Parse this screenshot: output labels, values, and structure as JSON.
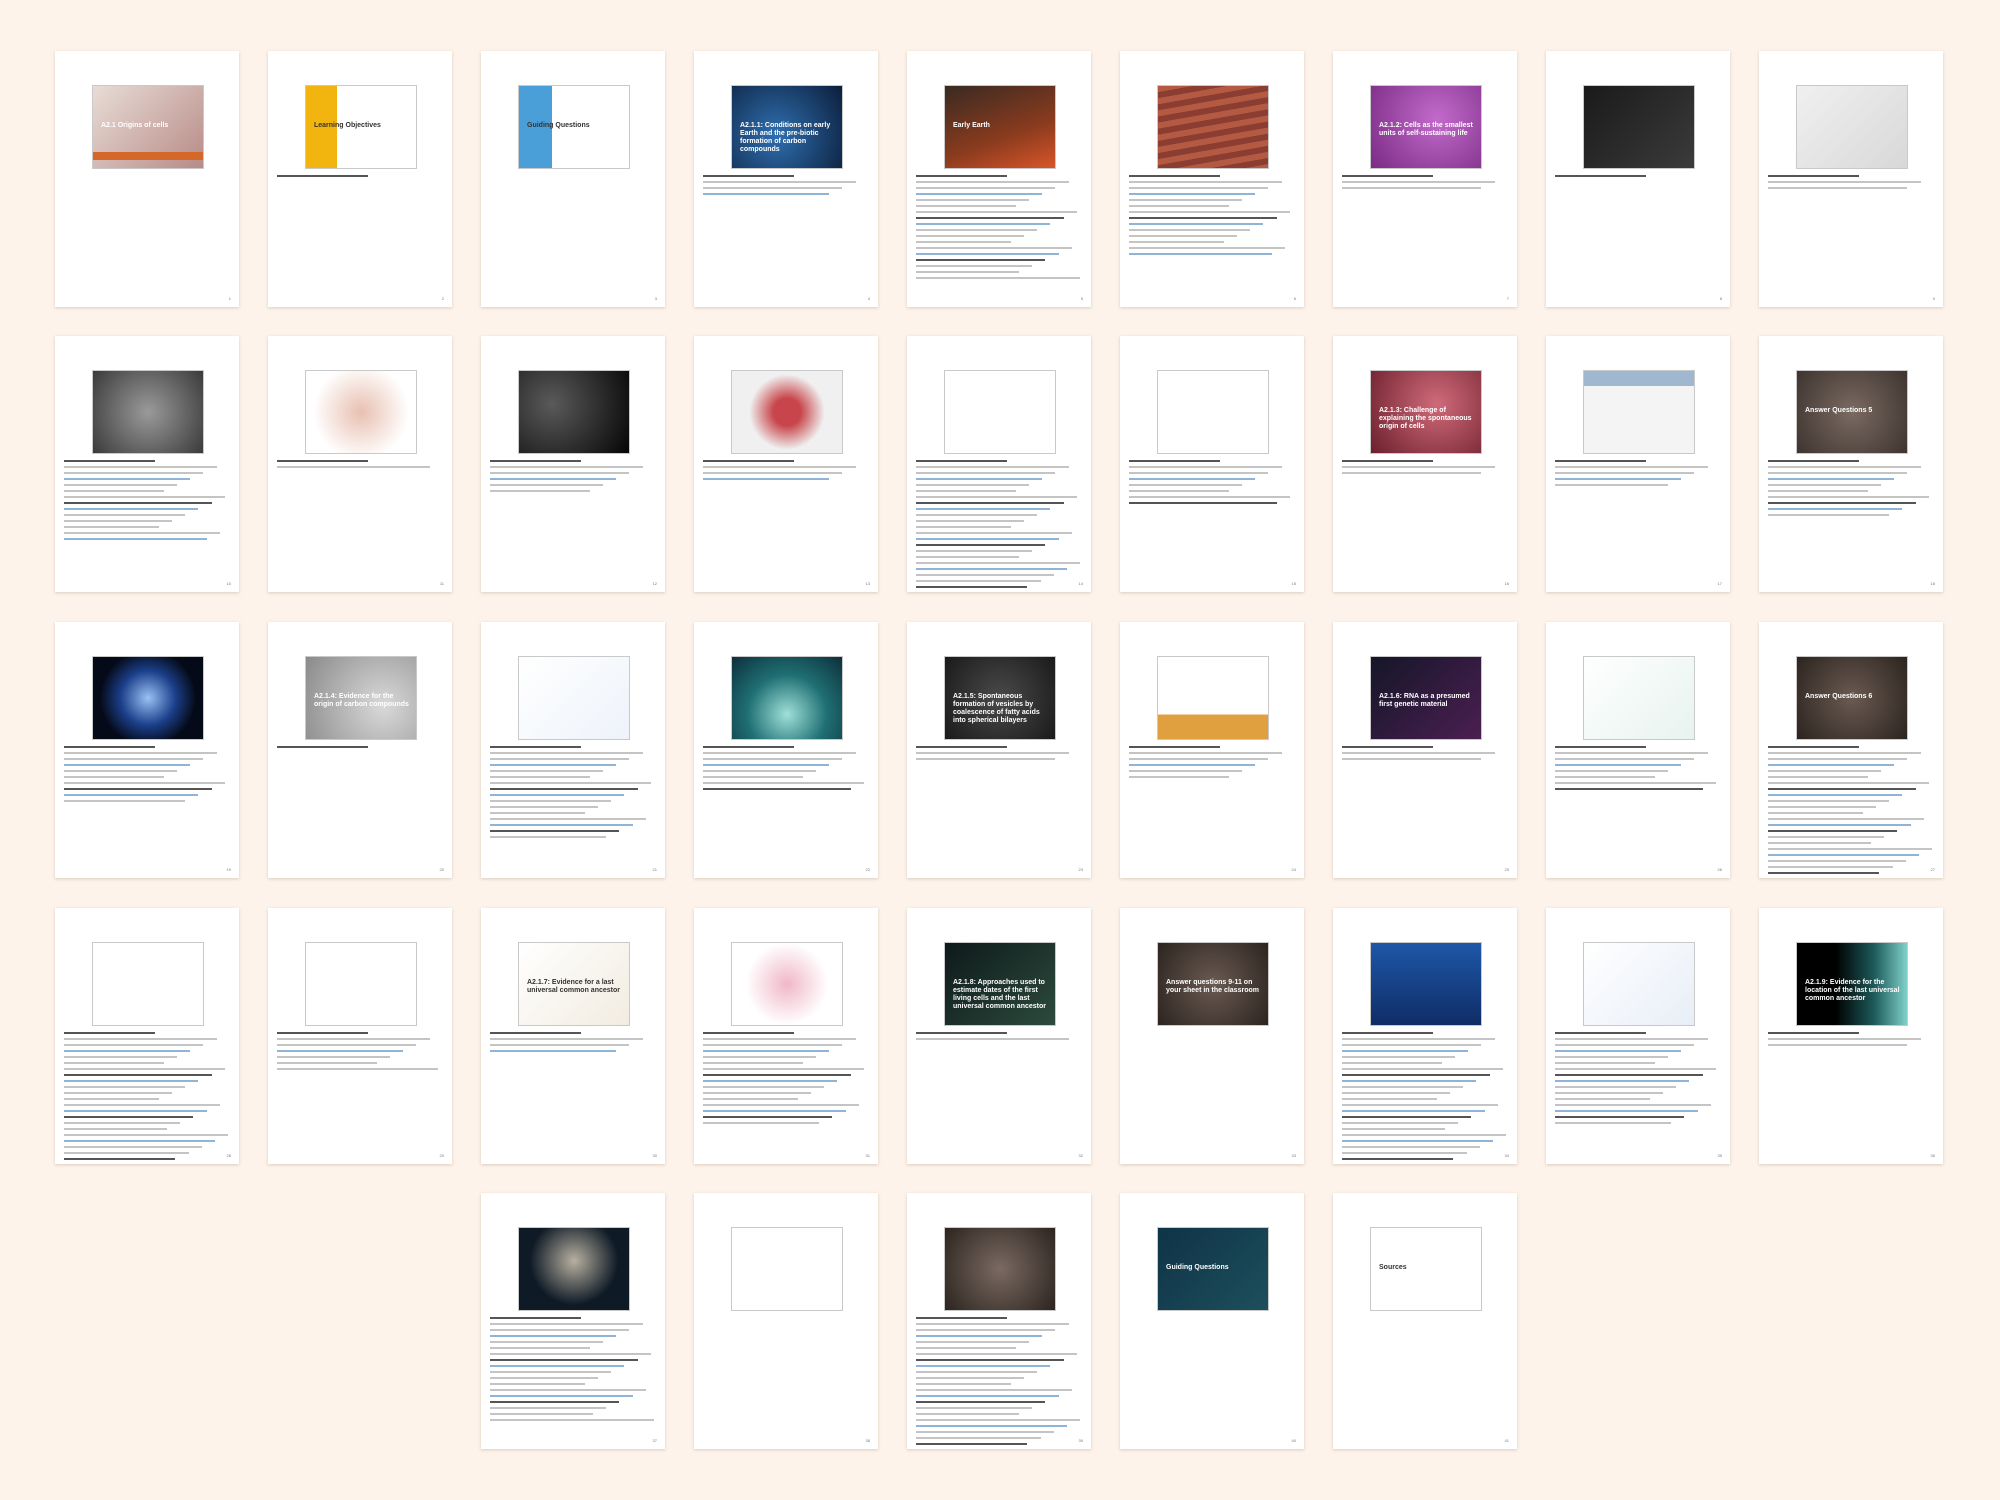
{
  "document": {
    "pages": [
      {
        "title": "A2.1 Origins of cells",
        "caption": "",
        "num": "1",
        "bg": "linear-gradient(135deg,#e8dcd6,#b88b87)",
        "bar": true,
        "dark": false,
        "lines": 0
      },
      {
        "title": "Learning Objectives",
        "caption": "",
        "num": "2",
        "bg": "linear-gradient(90deg,#f2b40f 0 28%,#ffffff 28%)",
        "bar": false,
        "dark": true,
        "lines": 1
      },
      {
        "title": "Guiding Questions",
        "caption": "",
        "num": "3",
        "bg": "linear-gradient(90deg,#4a9fd8 0 30%,#ffffff 30%)",
        "bar": false,
        "dark": true,
        "lines": 0
      },
      {
        "title": "A2.1.1: Conditions on early Earth and the pre-biotic formation of carbon compounds",
        "caption": "",
        "num": "4",
        "bg": "radial-gradient(circle at 40% 60%,#2f6fb0,#0b1e3a)",
        "bar": false,
        "dark": false,
        "lines": 4
      },
      {
        "title": "Early Earth",
        "caption": "",
        "num": "5",
        "bg": "linear-gradient(160deg,#3a2a22,#8a3b1e 60%,#d8552a)",
        "bar": false,
        "dark": false,
        "lines": 18
      },
      {
        "title": "",
        "caption": "",
        "num": "6",
        "bg": "repeating-linear-gradient(170deg,#b45a43 0 6px,#8a3d30 6px 12px)",
        "bar": false,
        "dark": false,
        "lines": 14
      },
      {
        "title": "A2.1.2: Cells as the smallest units of self-sustaining life",
        "caption": "",
        "num": "7",
        "bg": "radial-gradient(circle at 60% 40%,#c26acb,#7a2b84)",
        "bar": false,
        "dark": false,
        "lines": 3
      },
      {
        "title": "",
        "caption": "",
        "num": "8",
        "bg": "linear-gradient(135deg,#1a1a1a,#3b3b3b)",
        "bar": false,
        "dark": false,
        "lines": 1
      },
      {
        "title": "",
        "caption": "",
        "num": "9",
        "bg": "linear-gradient(135deg,#f0f0f0,#d8d8d8)",
        "bar": false,
        "dark": false,
        "lines": 3
      },
      {
        "title": "",
        "caption": "",
        "num": "10",
        "bg": "radial-gradient(circle,#9a9a9a,#3a3a3a)",
        "bar": false,
        "dark": false,
        "lines": 14
      },
      {
        "title": "",
        "caption": "",
        "num": "11",
        "bg": "radial-gradient(circle,#e8c0b0,#ffffff 70%)",
        "bar": false,
        "dark": false,
        "lines": 2
      },
      {
        "title": "",
        "caption": "",
        "num": "12",
        "bg": "radial-gradient(circle at 30% 40%,#5a5a5a,#050505)",
        "bar": false,
        "dark": false,
        "lines": 6
      },
      {
        "title": "",
        "caption": "",
        "num": "13",
        "bg": "radial-gradient(circle,#c8464b 20%,#f0f0f0 55%)",
        "bar": false,
        "dark": false,
        "lines": 4
      },
      {
        "title": "",
        "caption": "",
        "num": "14",
        "bg": "#ffffff",
        "bar": false,
        "dark": false,
        "lines": 28
      },
      {
        "title": "",
        "caption": "",
        "num": "15",
        "bg": "#ffffff",
        "bar": false,
        "dark": false,
        "lines": 8
      },
      {
        "title": "A2.1.3: Challenge of explaining the spontaneous origin of cells",
        "caption": "",
        "num": "16",
        "bg": "radial-gradient(circle at 60% 40%,#d06a7a,#6b1f2c)",
        "bar": false,
        "dark": false,
        "lines": 3
      },
      {
        "title": "",
        "caption": "",
        "num": "17",
        "bg": "linear-gradient(#9fb8cf 0 18%,#f4f4f4 18%)",
        "bar": false,
        "dark": false,
        "lines": 5
      },
      {
        "title": "Answer Questions 5",
        "caption": "",
        "num": "18",
        "bg": "radial-gradient(circle,#7a6a62,#3e342f)",
        "bar": false,
        "dark": false,
        "lines": 10
      },
      {
        "title": "",
        "caption": "",
        "num": "19",
        "bg": "radial-gradient(circle,#9bc1f5,#1b3f8a 40%,#050a18 70%)",
        "bar": false,
        "dark": false,
        "lines": 10
      },
      {
        "title": "A2.1.4: Evidence for the origin of carbon compounds",
        "caption": "",
        "num": "20",
        "bg": "radial-gradient(circle at 70% 60%,#d9d9d9,#8a8a8a)",
        "bar": false,
        "dark": false,
        "lines": 1
      },
      {
        "title": "",
        "caption": "",
        "num": "21",
        "bg": "linear-gradient(135deg,#ffffff,#eef3fa)",
        "bar": false,
        "dark": false,
        "lines": 16
      },
      {
        "title": "",
        "caption": "",
        "num": "22",
        "bg": "radial-gradient(circle at 50% 70%,#9fe0d9,#1f6f73 50%,#0d2f3a)",
        "bar": false,
        "dark": false,
        "lines": 8
      },
      {
        "title": "A2.1.5: Spontaneous formation of vesicles by coalescence of fatty acids into spherical bilayers",
        "caption": "",
        "num": "23",
        "bg": "radial-gradient(circle,#4a4a4a,#1a1a1a)",
        "bar": false,
        "dark": false,
        "lines": 3
      },
      {
        "title": "",
        "caption": "",
        "num": "24",
        "bg": "linear-gradient(#ffffff 0 70%,#e0a040 70%)",
        "bar": false,
        "dark": false,
        "lines": 6
      },
      {
        "title": "A2.1.6: RNA as a presumed first genetic material",
        "caption": "",
        "num": "25",
        "bg": "linear-gradient(135deg,#151628,#4b1f52)",
        "bar": false,
        "dark": false,
        "lines": 3
      },
      {
        "title": "",
        "caption": "",
        "num": "26",
        "bg": "linear-gradient(135deg,#ffffff,#e7f3ee)",
        "bar": false,
        "dark": false,
        "lines": 8
      },
      {
        "title": "Answer Questions 6",
        "caption": "",
        "num": "27",
        "bg": "radial-gradient(circle,#6a5a52,#2c241f)",
        "bar": false,
        "dark": false,
        "lines": 22
      },
      {
        "title": "",
        "caption": "",
        "num": "28",
        "bg": "#ffffff",
        "bar": false,
        "dark": false,
        "lines": 22
      },
      {
        "title": "",
        "caption": "",
        "num": "29",
        "bg": "#ffffff",
        "bar": false,
        "dark": false,
        "lines": 7
      },
      {
        "title": "A2.1.7: Evidence for a last universal common ancestor",
        "caption": "",
        "num": "30",
        "bg": "linear-gradient(135deg,#ffffff,#f2ece0)",
        "bar": false,
        "dark": true,
        "lines": 4
      },
      {
        "title": "",
        "caption": "",
        "num": "31",
        "bg": "radial-gradient(circle,#f0b7c7,#ffffff 60%)",
        "bar": false,
        "dark": false,
        "lines": 16
      },
      {
        "title": "A2.1.8: Approaches used to estimate dates of the first living cells and the last universal common ancestor",
        "caption": "",
        "num": "32",
        "bg": "linear-gradient(135deg,#0e1a1a,#2c4a3d)",
        "bar": false,
        "dark": false,
        "lines": 2
      },
      {
        "title": "Answer questions 9-11 on your sheet in the classroom",
        "caption": "",
        "num": "33",
        "bg": "radial-gradient(circle,#6a5a52,#2c241f)",
        "bar": false,
        "dark": false,
        "lines": 0
      },
      {
        "title": "",
        "caption": "",
        "num": "34",
        "bg": "linear-gradient(#1e57a8,#0f2d66)",
        "bar": false,
        "dark": false,
        "lines": 26
      },
      {
        "title": "",
        "caption": "",
        "num": "35",
        "bg": "linear-gradient(135deg,#ffffff,#e8eef7)",
        "bar": false,
        "dark": false,
        "lines": 16
      },
      {
        "title": "A2.1.9: Evidence for the location of the last universal common ancestor",
        "caption": "",
        "num": "36",
        "bg": "linear-gradient(90deg,#000000 0 35%,#1d5a5a 70%,#7fd0c9)",
        "bar": false,
        "dark": false,
        "lines": 3
      },
      {
        "title": "",
        "caption": "",
        "num": "37",
        "bg": "radial-gradient(circle at 50% 40%,#b8b0a0,#0e1a26 60%)",
        "bar": false,
        "dark": false,
        "lines": 18
      },
      {
        "title": "",
        "caption": "",
        "num": "38",
        "bg": "#ffffff",
        "bar": false,
        "dark": false,
        "lines": 0
      },
      {
        "title": "",
        "caption": "",
        "num": "39",
        "bg": "radial-gradient(circle,#7a6a62,#2c241f)",
        "bar": false,
        "dark": false,
        "lines": 24
      },
      {
        "title": "Guiding Questions",
        "caption": "",
        "num": "40",
        "bg": "linear-gradient(135deg,#0f3347,#1d4f5c)",
        "bar": false,
        "dark": false,
        "lines": 0
      },
      {
        "title": "Sources",
        "caption": "",
        "num": "41",
        "bg": "#ffffff",
        "bar": false,
        "dark": true,
        "lines": 0
      }
    ]
  },
  "colors": {
    "background": "#fdf3ea",
    "page": "#ffffff",
    "accent_bar": "#d4682a"
  }
}
